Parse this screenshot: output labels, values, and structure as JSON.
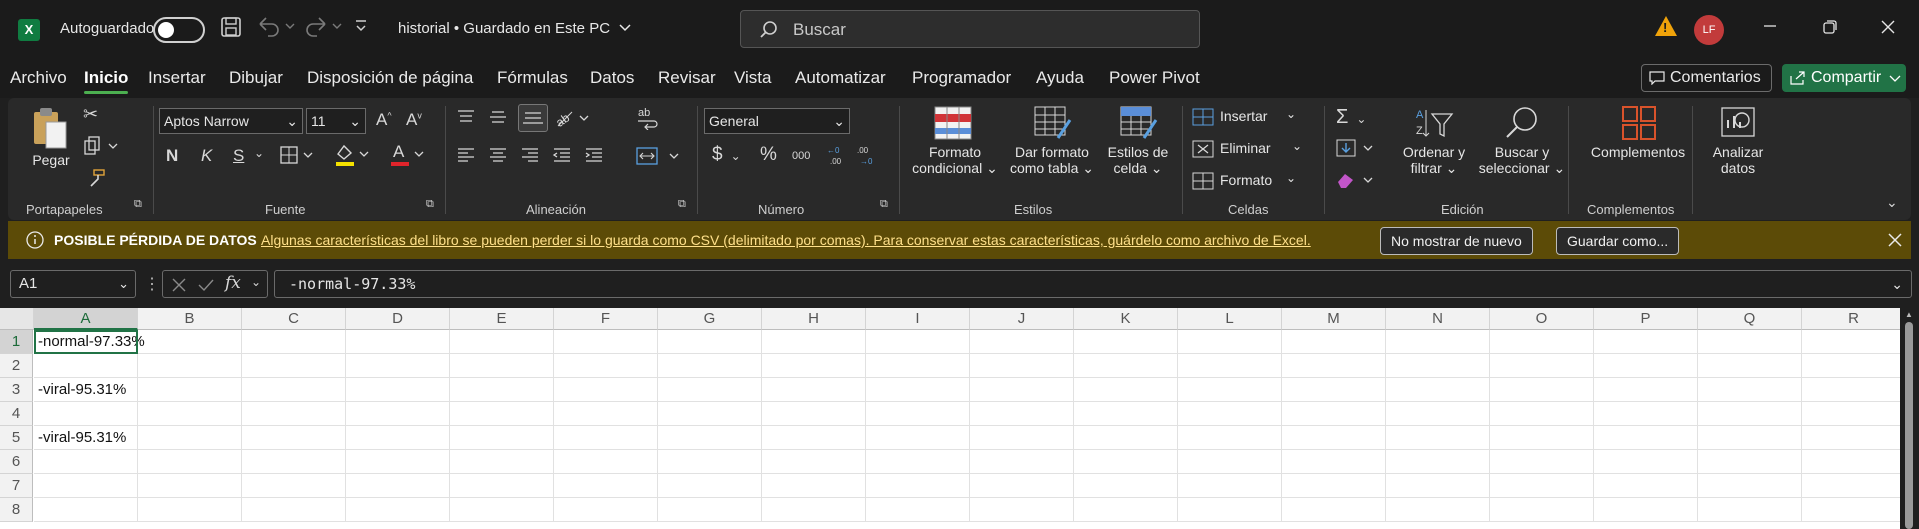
{
  "titlebar": {
    "app_icon": "X",
    "autosave_label": "Autoguardado",
    "document_title": "historial • Guardado en Este PC",
    "search_placeholder": "Buscar",
    "avatar_initials": "LF"
  },
  "menu": {
    "items": [
      "Archivo",
      "Inicio",
      "Insertar",
      "Dibujar",
      "Disposición de página",
      "Fórmulas",
      "Datos",
      "Revisar",
      "Vista",
      "Automatizar",
      "Programador",
      "Ayuda",
      "Power Pivot"
    ],
    "active": "Inicio",
    "comments_label": "Comentarios",
    "share_label": "Compartir"
  },
  "ribbon": {
    "paste_label": "Pegar",
    "groups": {
      "clipboard": "Portapapeles",
      "font": "Fuente",
      "alignment": "Alineación",
      "number": "Número",
      "styles": "Estilos",
      "cells": "Celdas",
      "editing": "Edición",
      "addins": "Complementos"
    },
    "font_name": "Aptos Narrow",
    "font_size": "11",
    "number_format": "General",
    "conditional_format": [
      "Formato",
      "condicional"
    ],
    "format_as_table": [
      "Dar formato",
      "como tabla"
    ],
    "cell_styles": [
      "Estilos de",
      "celda"
    ],
    "insert_label": "Insertar",
    "delete_label": "Eliminar",
    "format_label": "Formato",
    "sort_filter": [
      "Ordenar y",
      "filtrar"
    ],
    "find_select": [
      "Buscar y",
      "seleccionar"
    ],
    "addins_label": "Complementos",
    "analyze": [
      "Analizar",
      "datos"
    ],
    "bold": "N",
    "italic": "K",
    "underline": "S",
    "font_color_glyph": "A",
    "currency_glyph": "$",
    "percent_glyph": "%",
    "thousands_glyph": "000"
  },
  "warning_bar": {
    "title": "POSIBLE PÉRDIDA DE DATOS",
    "message": "Algunas características del libro se pueden perder si lo guarda como CSV (delimitado por comas). Para conservar estas características, guárdelo como archivo de Excel.",
    "dont_show_label": "No mostrar de nuevo",
    "save_as_label": "Guardar como..."
  },
  "formula_bar": {
    "name_box": "A1",
    "fx_label": "fx",
    "formula": "-normal-97.33%"
  },
  "sheet": {
    "columns": [
      "A",
      "B",
      "C",
      "D",
      "E",
      "F",
      "G",
      "H",
      "I",
      "J",
      "K",
      "L",
      "M",
      "N",
      "O",
      "P",
      "Q",
      "R"
    ],
    "rows": [
      "1",
      "2",
      "3",
      "4",
      "5",
      "6",
      "7",
      "8"
    ],
    "cells": {
      "A1": "-normal-97.33%",
      "A3": "-viral-95.31%",
      "A5": "-viral-95.31%"
    }
  },
  "colors": {
    "accent_green": "#217346",
    "warning_bar": "#5c4b07",
    "avatar": "#c23b3b"
  }
}
